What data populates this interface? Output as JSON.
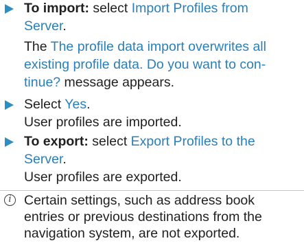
{
  "import_step": {
    "label": "To import:",
    "text_before": " select ",
    "link": "Import Profiles from",
    "link_cont": "Server",
    "text_after": ".",
    "message_prefix": "The ",
    "message_line1": "The profile data import overwrites all",
    "message_line2": "existing profile data. Do you want to con-",
    "message_line3_link": "tinue?",
    "message_suffix": " message appears."
  },
  "yes_step": {
    "text": "Select ",
    "link": "Yes",
    "text_after": ".",
    "result": "User profiles are imported."
  },
  "export_step": {
    "label": "To export:",
    "text_before": " select ",
    "link": "Export Profiles to the",
    "link_cont": "Server",
    "text_after": ".",
    "result": "User profiles are exported."
  },
  "note": {
    "icon": "info-icon",
    "line1": "Certain settings, such as address book",
    "line2": "entries or previous destinations from the",
    "line3": "navigation system, are not exported."
  }
}
